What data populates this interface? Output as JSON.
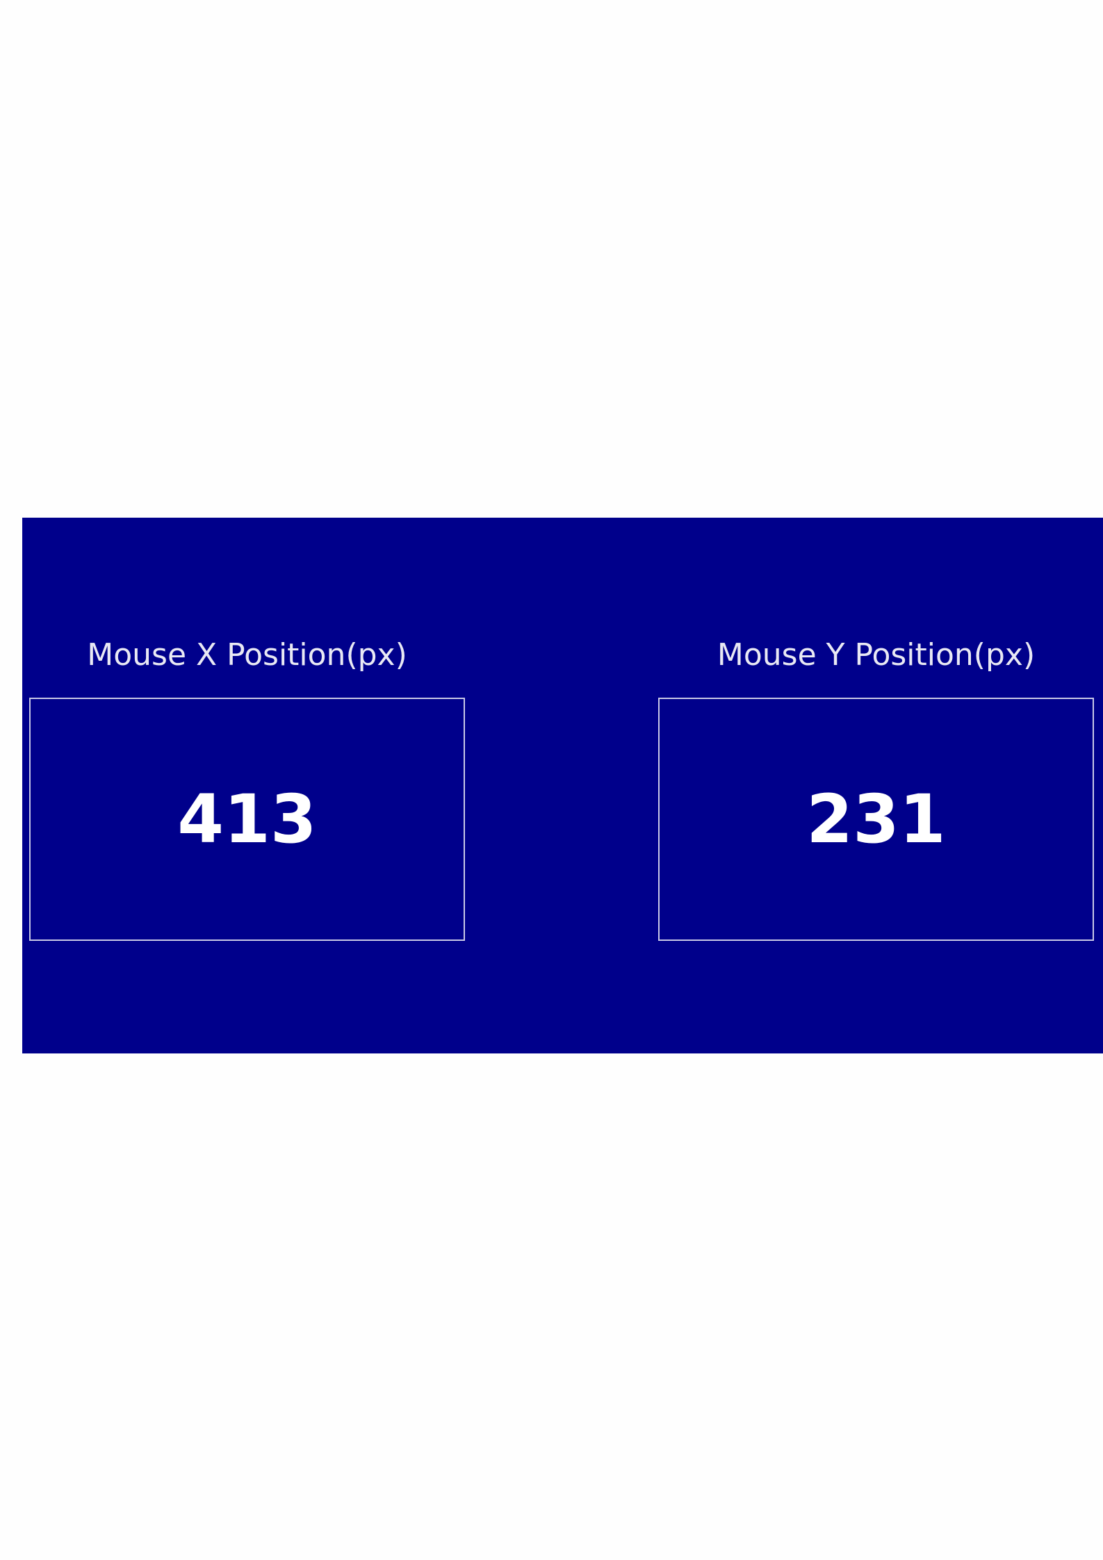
{
  "colors": {
    "page_background": "#fefefe",
    "panel_background": "#00008b",
    "label_text": "#e9e9f4",
    "value_text": "#ffffff",
    "box_border": "#c9c9e6"
  },
  "mouse_x": {
    "label": "Mouse X Position(px)",
    "value": "413"
  },
  "mouse_y": {
    "label": "Mouse Y Position(px)",
    "value": "231"
  }
}
